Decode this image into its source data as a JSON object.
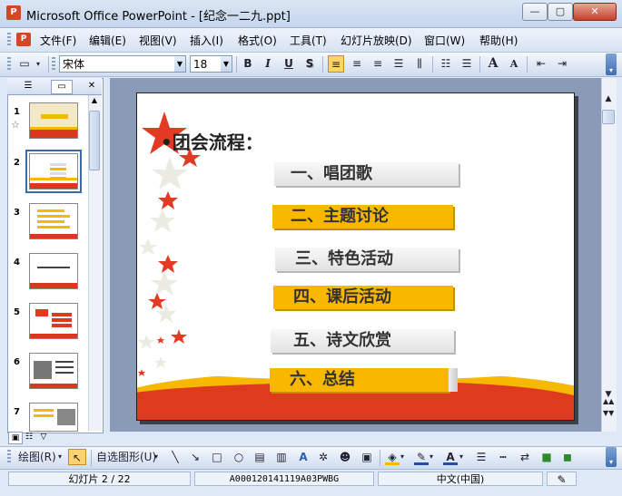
{
  "window": {
    "app_icon": "P",
    "title": "Microsoft Office PowerPoint - [纪念一二九.ppt]",
    "min_glyph": "—",
    "max_glyph": "▢",
    "close_glyph": "✕"
  },
  "menu": {
    "items": [
      "文件(F)",
      "编辑(E)",
      "视图(V)",
      "插入(I)",
      "格式(O)",
      "工具(T)",
      "幻灯片放映(D)",
      "窗口(W)",
      "帮助(H)"
    ]
  },
  "toolbar": {
    "font_name": "宋体",
    "font_size": "18",
    "bold": "B",
    "italic": "I",
    "underline": "U",
    "shadow": "S",
    "grow_font": "A",
    "shrink_font": "A"
  },
  "left_pane": {
    "tab_outline_glyph": "☰",
    "tab_slides_glyph": "▭",
    "close_glyph": "✕",
    "slide_numbers": [
      "1",
      "2",
      "3",
      "4",
      "5",
      "6",
      "7"
    ],
    "transition_icon": "☆"
  },
  "slide": {
    "title": "•团会流程：",
    "items": [
      "一、唱团歌",
      "二、主题讨论",
      "三、特色活动",
      "四、课后活动",
      "五、诗文欣赏",
      "六、总结"
    ]
  },
  "drawbar": {
    "draw_label": "绘图(R)",
    "autoshapes_label": "自选图形(U)"
  },
  "status": {
    "slide_info": "幻灯片 2 / 22",
    "template_name": "A000120141119A03PWBG",
    "language": "中文(中国)"
  },
  "colors": {
    "accent_yellow": "#f9b700",
    "accent_red": "#de3b1e",
    "title_bar": "#c4d5ec"
  }
}
